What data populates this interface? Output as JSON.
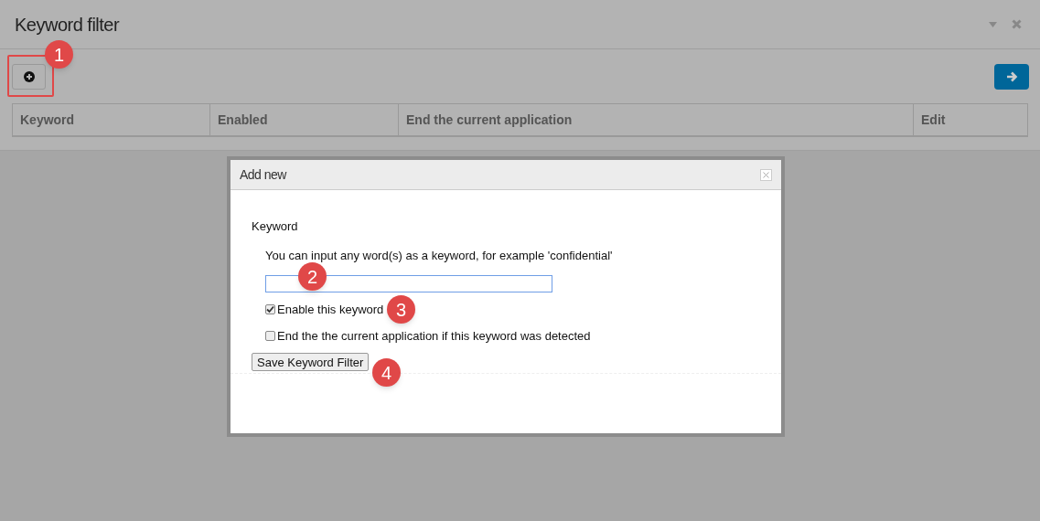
{
  "page": {
    "title": "Keyword filter"
  },
  "table": {
    "columns": [
      "Keyword",
      "Enabled",
      "End the current application",
      "Edit"
    ]
  },
  "dialog": {
    "title": "Add new",
    "section": "Keyword",
    "hint": "You can input any word(s) as a keyword, for example 'confidential'",
    "options": [
      {
        "label": "Enable this keyword",
        "checked": true
      },
      {
        "label": "End the the current application if this keyword was detected",
        "checked": false
      }
    ],
    "save_button": "Save Keyword Filter"
  },
  "callouts": [
    "1",
    "2",
    "3",
    "4"
  ]
}
